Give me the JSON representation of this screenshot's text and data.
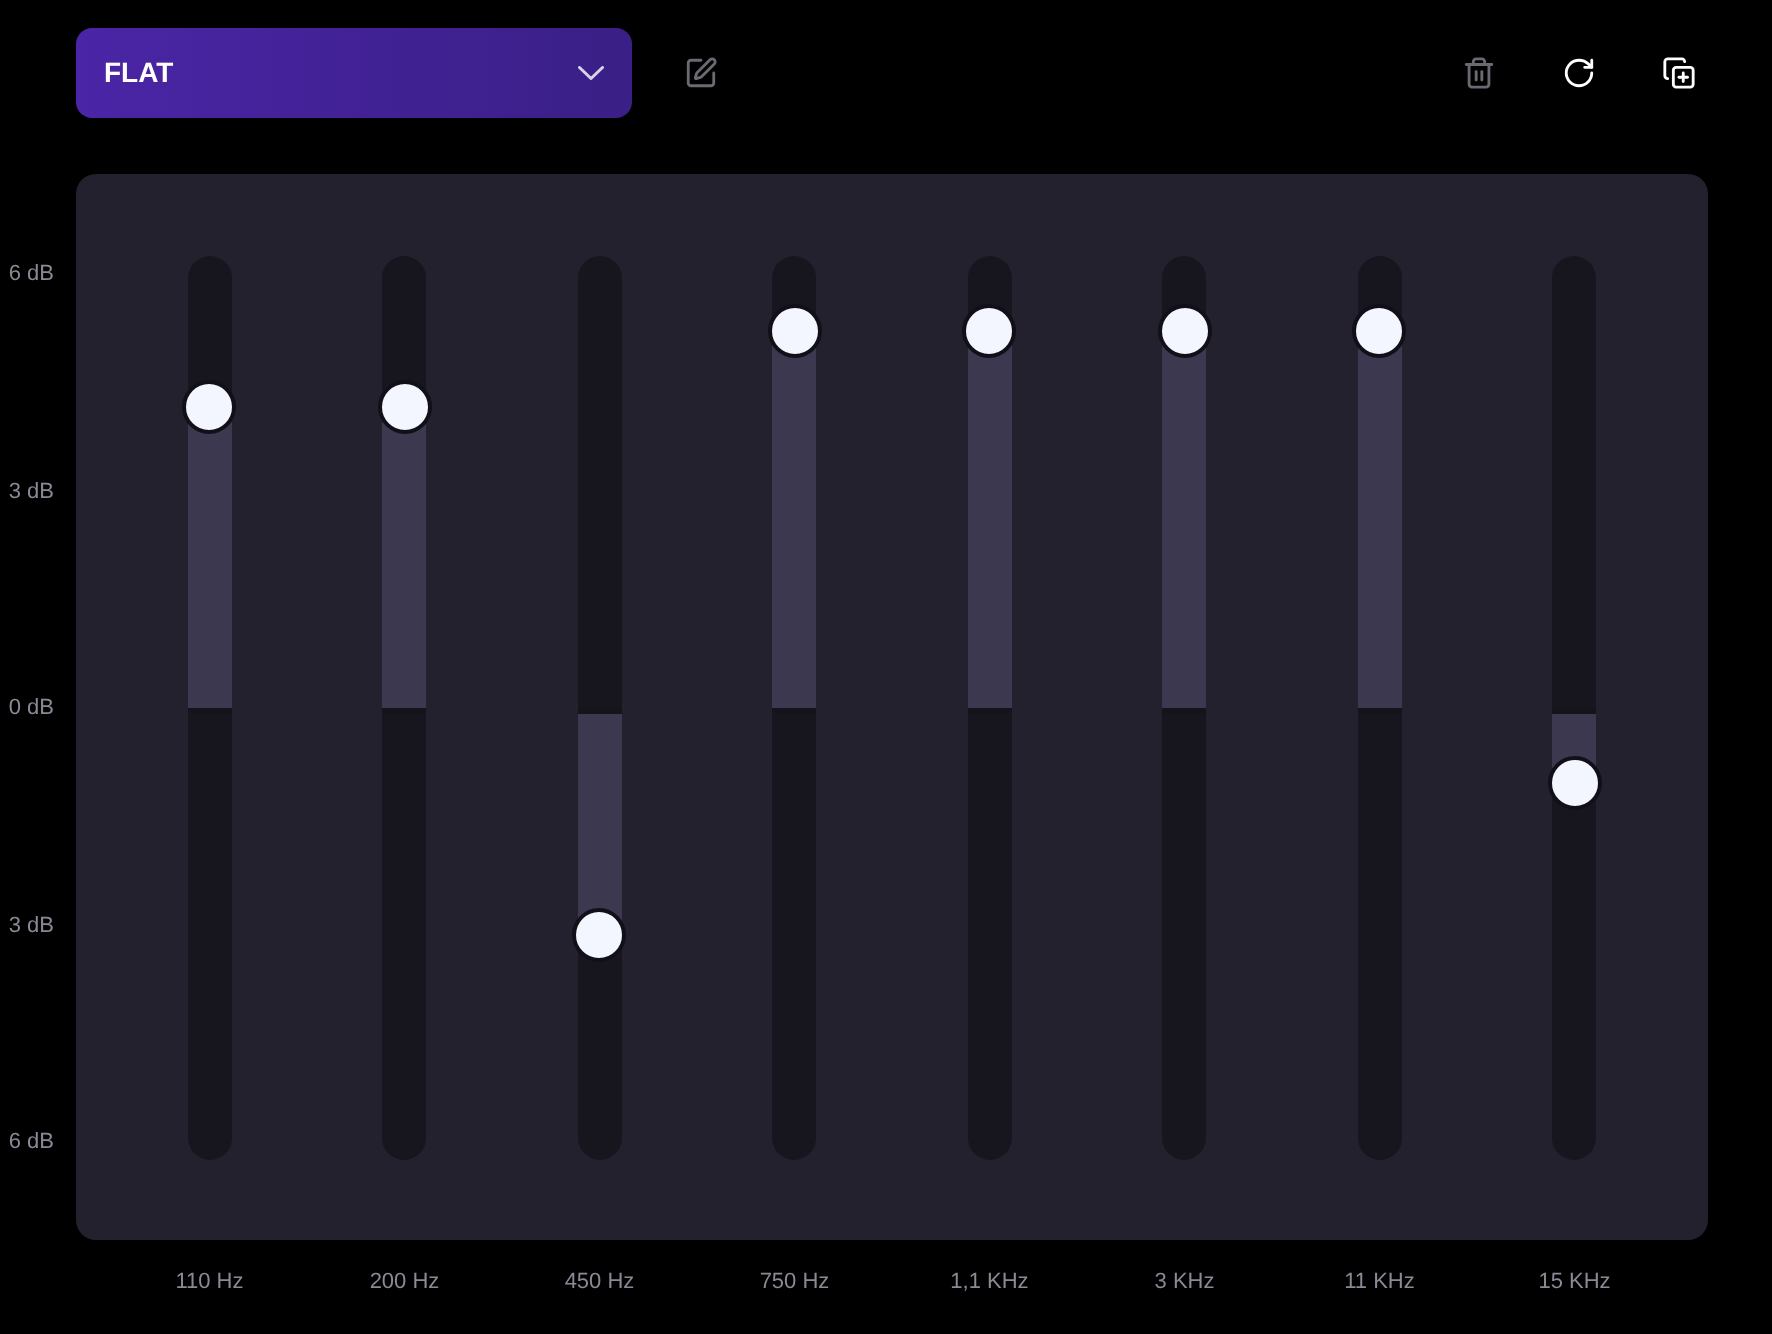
{
  "preset": {
    "label": "FLAT"
  },
  "toolbar": [
    {
      "kind": "edit",
      "disabled": true
    },
    {
      "kind": "delete",
      "disabled": true
    },
    {
      "kind": "reset",
      "disabled": false
    },
    {
      "kind": "duplicate",
      "disabled": false
    }
  ],
  "scale": [
    "6 dB",
    "3 dB",
    "0 dB",
    "3 dB",
    "6 dB"
  ],
  "bands": [
    {
      "label": "110 Hz",
      "level": 0.833
    },
    {
      "label": "200 Hz",
      "level": 0.833
    },
    {
      "label": "450 Hz",
      "level": 0.25
    },
    {
      "label": "750 Hz",
      "level": 0.917
    },
    {
      "label": "1,1 KHz",
      "level": 0.917
    },
    {
      "label": "3 KHz",
      "level": 0.917
    },
    {
      "label": "11 KHz",
      "level": 0.917
    },
    {
      "label": "15 KHz",
      "level": 0.417
    }
  ]
}
